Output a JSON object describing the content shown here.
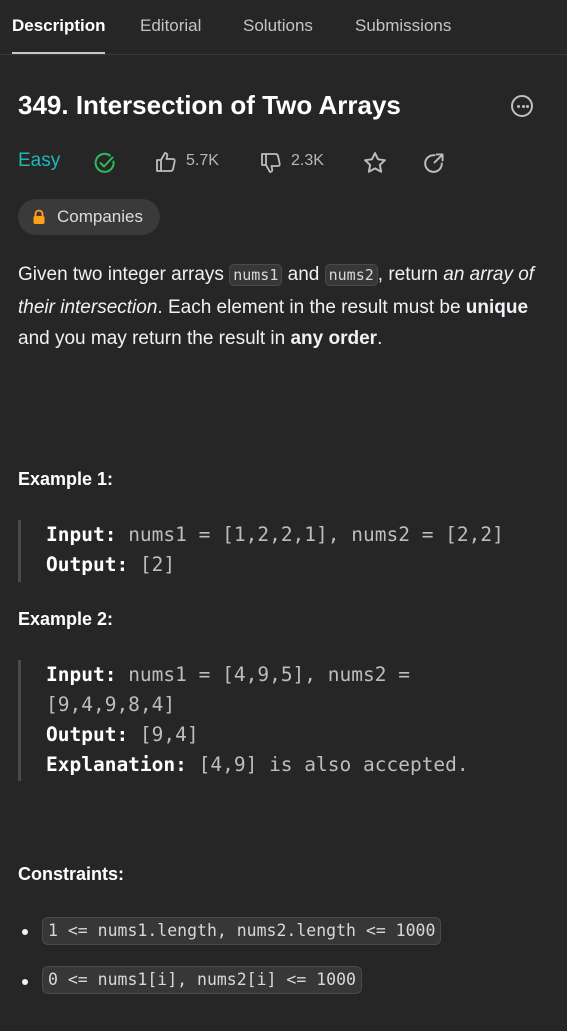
{
  "tabs": [
    "Description",
    "Editorial",
    "Solutions",
    "Submissions"
  ],
  "problem": {
    "title": "349. Intersection of Two Arrays",
    "difficulty": "Easy",
    "likes": "5.7K",
    "dislikes": "2.3K",
    "companies_label": "Companies"
  },
  "description": {
    "p1": "Given two integer arrays ",
    "code1": "nums1",
    "p2": " and ",
    "code2": "nums2",
    "p3": ", return ",
    "em": "an array of their intersection",
    "p4": ". Each element in the result must be ",
    "b1": "unique",
    "p5": " and you may return the result in ",
    "b2": "any order",
    "p6": "."
  },
  "examples": [
    {
      "heading": "Example 1:",
      "input_label": "Input:",
      "input_line1": " nums1 = [1,2,2,1], nums2 = [2,2]",
      "output_label": "Output:",
      "output": " [2]"
    },
    {
      "heading": "Example 2:",
      "input_label": "Input:",
      "input_line1": " nums1 = [4,9,5], nums2 =",
      "input_line2": "[9,4,9,8,4]",
      "output_label": "Output:",
      "output": " [9,4]",
      "explanation_label": "Explanation:",
      "explanation": " [4,9] is also accepted."
    }
  ],
  "constraints_heading": "Constraints:",
  "constraints": [
    "1 <= nums1.length, nums2.length <= 1000",
    "0 <= nums1[i], nums2[i] <= 1000"
  ],
  "colors": {
    "background": "#262626",
    "easy": "#1cb8b8",
    "solved_check": "#2cbb5d",
    "lock": "#ffa116"
  },
  "icons": [
    "solved-check-icon",
    "thumbs-up-icon",
    "thumbs-down-icon",
    "star-icon",
    "share-icon",
    "lock-icon",
    "more-icon"
  ]
}
